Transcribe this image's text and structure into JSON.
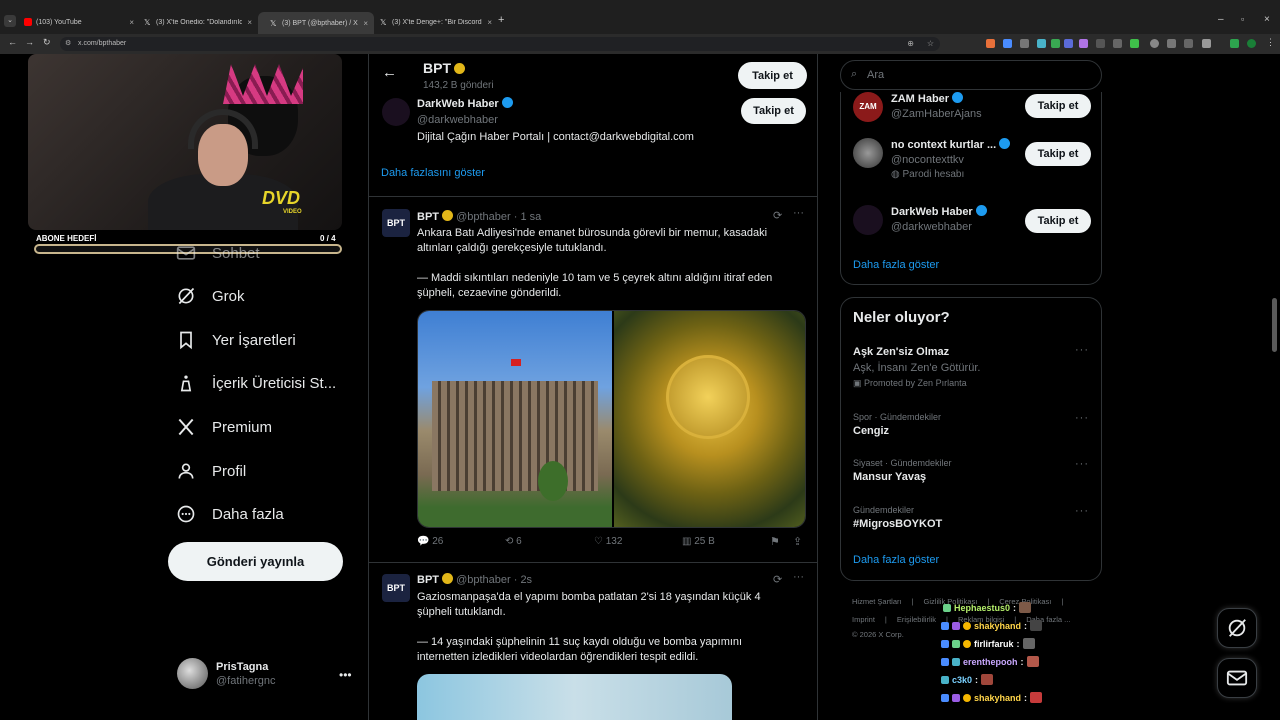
{
  "browser": {
    "tabs": [
      {
        "title": "(103) YouTube",
        "active": false
      },
      {
        "title": "(3) X'te Onedio: \"Dolandırıldığ",
        "active": false
      },
      {
        "title": "(3) BPT (@bpthaber) / X",
        "active": true
      },
      {
        "title": "(3) X'te Denge+: \"Bir Discord k",
        "active": false
      }
    ],
    "url": "x.com/bpthaber"
  },
  "stream": {
    "goal_label": "ABONE HEDEFİ",
    "goal_count": "0 / 4",
    "goal_progress": 0,
    "dvd_logo": "DVD",
    "dvd_sub": "VIDEO"
  },
  "nav": {
    "items": [
      {
        "label": "Sohbet",
        "icon": "mail-icon"
      },
      {
        "label": "Grok",
        "icon": "grok-icon"
      },
      {
        "label": "Yer İşaretleri",
        "icon": "bookmark-icon"
      },
      {
        "label": "İçerik Üreticisi St...",
        "icon": "creator-icon"
      },
      {
        "label": "Premium",
        "icon": "x-logo-icon"
      },
      {
        "label": "Profil",
        "icon": "person-icon"
      },
      {
        "label": "Daha fazla",
        "icon": "more-circle-icon"
      }
    ],
    "post_button": "Gönderi yayınla",
    "account": {
      "name": "PrisTagna",
      "handle": "@fatihergnc"
    }
  },
  "profile_header": {
    "name": "BPT",
    "posts": "143,2 B gönderi",
    "follow": "Takip et"
  },
  "suggestion": {
    "name": "DarkWeb Haber",
    "handle": "@darkwebhaber",
    "bio": "Dijital Çağın Haber Portalı | contact@darkwebdigital.com",
    "follow": "Takip et",
    "show_more": "Daha fazlasını göster"
  },
  "tweets": [
    {
      "name": "BPT",
      "handle": "@bpthaber",
      "time": "· 1 sa",
      "line1": "Ankara Batı Adliyesi'nde emanet bürosunda görevli bir memur, kasadaki",
      "line2": "altınları çaldığı gerekçesiyle tutuklandı.",
      "line3": "— Maddi sıkıntıları nedeniyle 10 tam ve 5 çeyrek altını aldığını itiraf eden",
      "line4": "şüpheli, cezaevine gönderildi.",
      "replies": "26",
      "reposts": "6",
      "likes": "132",
      "views": "25 B"
    },
    {
      "name": "BPT",
      "handle": "@bpthaber",
      "time": "· 2s",
      "line1": "Gaziosmanpaşa'da el yapımı bomba patlatan 2'si 18 yaşından küçük 4",
      "line2": "şüpheli tutuklandı.",
      "line3": "— 14 yaşındaki şüphelinin 11 suç kaydı olduğu ve bomba yapımını",
      "line4": "internetten izledikleri videolardan öğrendikleri tespit edildi."
    }
  ],
  "right": {
    "search_placeholder": "Ara",
    "who_to_follow": [
      {
        "name": "ZAM Haber",
        "handle": "@ZamHaberAjans",
        "follow": "Takip et"
      },
      {
        "name": "no context kurtlar ...",
        "handle": "@nocontexttkv",
        "note": "Parodi hesabı",
        "follow": "Takip et"
      },
      {
        "name": "DarkWeb Haber",
        "handle": "@darkwebhaber",
        "follow": "Takip et"
      }
    ],
    "who_show_more": "Daha fazla göster",
    "trends_title": "Neler oluyor?",
    "trends": [
      {
        "category": "",
        "name": "Aşk Zen'siz Olmaz",
        "sub": "Aşk, İnsanı Zen'e Götürür.",
        "promo": "Promoted by Zen Pırlanta"
      },
      {
        "category": "Spor · Gündemdekiler",
        "name": "Cengiz"
      },
      {
        "category": "Siyaset · Gündemdekiler",
        "name": "Mansur Yavaş"
      },
      {
        "category": "Gündemdekiler",
        "name": "#MigrosBOYKOT"
      }
    ],
    "trends_show_more": "Daha fazla göster",
    "footer": {
      "line1": [
        "Hizmet Şartları",
        "Gizlilik Politikası",
        "Çerez Politikası"
      ],
      "line2": [
        "Imprint",
        "Erişilebilirlik",
        "Reklam bilgisi",
        "Daha fazla ..."
      ],
      "copyright": "© 2026 X Corp."
    }
  },
  "chat": [
    {
      "user": "Hephaestus0",
      "color": "#b5f06b"
    },
    {
      "user": "shakyhand",
      "color": "#ffd54a"
    },
    {
      "user": "firlirfaruk",
      "color": "#ffffff"
    },
    {
      "user": "erenthepooh",
      "color": "#c9a8ff"
    },
    {
      "user": "c3k0",
      "color": "#7ad1ff"
    },
    {
      "user": "shakyhand",
      "color": "#ffd54a"
    }
  ],
  "colors": {
    "accent": "#1d9bf0",
    "verified_gold": "#e2b719",
    "verified_blue": "#1d9bf0"
  }
}
